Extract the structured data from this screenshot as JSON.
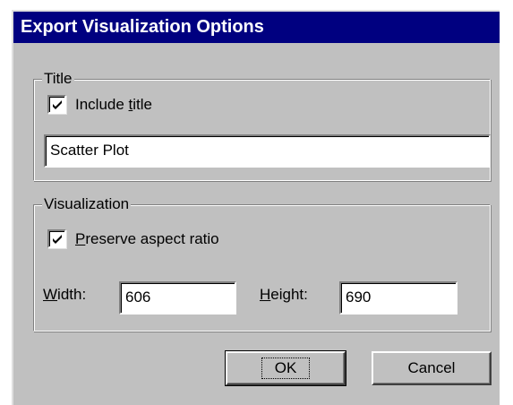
{
  "dialog": {
    "title": "Export Visualization Options"
  },
  "title_group": {
    "label": "Title",
    "include_title": {
      "label_pre": "Include ",
      "label_mnemonic": "t",
      "label_post": "itle",
      "checked": true
    },
    "title_field": {
      "value": "Scatter Plot"
    }
  },
  "visualization_group": {
    "label": "Visualization",
    "preserve_aspect": {
      "label_mnemonic": "P",
      "label_post": "reserve aspect ratio",
      "checked": true
    },
    "width": {
      "label_mnemonic": "W",
      "label_post": "idth:",
      "value": "606"
    },
    "height": {
      "label_mnemonic": "H",
      "label_post": "eight:",
      "value": "690"
    }
  },
  "buttons": {
    "ok_label": "OK",
    "cancel_label": "Cancel"
  }
}
